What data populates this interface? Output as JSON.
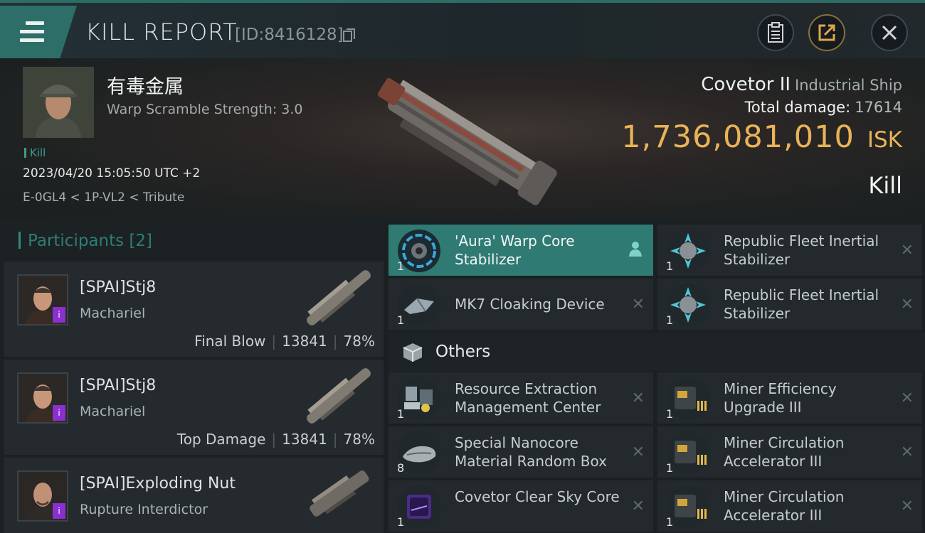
{
  "header": {
    "title": "KILL REPORT",
    "kill_id": "[ID:8416128]"
  },
  "victim": {
    "name": "有毒金属",
    "warp_scramble": "Warp Scramble Strength: 3.0",
    "tag": "Kill",
    "datetime": "2023/04/20 15:05:50 UTC +2",
    "location": "E-0GL4 < 1P-VL2 < Tribute",
    "ship_name": "Covetor II",
    "ship_class": "Industrial Ship",
    "total_damage_label": "Total damage:",
    "total_damage": "17614",
    "isk_value": "1,736,081,010",
    "isk_unit": "ISK",
    "result": "Kill"
  },
  "participants": {
    "header": "Participants [2]",
    "items": [
      {
        "name": "[SPAI]Stj8",
        "ship": "Machariel",
        "role": "Final Blow",
        "damage": "13841",
        "percent": "78%"
      },
      {
        "name": "[SPAI]Stj8",
        "ship": "Machariel",
        "role": "Top Damage",
        "damage": "13841",
        "percent": "78%"
      },
      {
        "name": "[SPAI]Exploding Nut",
        "ship": "Rupture Interdictor"
      }
    ]
  },
  "modules": {
    "fitted": [
      {
        "name": "'Aura' Warp Core Stabilizer",
        "qty": "1"
      },
      {
        "name": "Republic Fleet Inertial Stabilizer",
        "qty": "1"
      },
      {
        "name": "MK7 Cloaking Device",
        "qty": "1"
      },
      {
        "name": "Republic Fleet Inertial Stabilizer",
        "qty": "1"
      }
    ],
    "others_label": "Others",
    "others": [
      {
        "name": "Resource Extraction Management Center",
        "qty": "1"
      },
      {
        "name": "Miner Efficiency Upgrade III",
        "qty": "1"
      },
      {
        "name": "Special Nanocore Material Random Box",
        "qty": "8"
      },
      {
        "name": "Miner Circulation Accelerator III",
        "qty": "1"
      },
      {
        "name": "Covetor Clear Sky Core",
        "qty": "1"
      },
      {
        "name": "Miner Circulation Accelerator III",
        "qty": "1"
      }
    ],
    "close_glyph": "✕"
  },
  "colors": {
    "accent_teal": "#2f7a72",
    "isk_gold": "#e9b356",
    "level_purple": "#8a2fd0"
  }
}
